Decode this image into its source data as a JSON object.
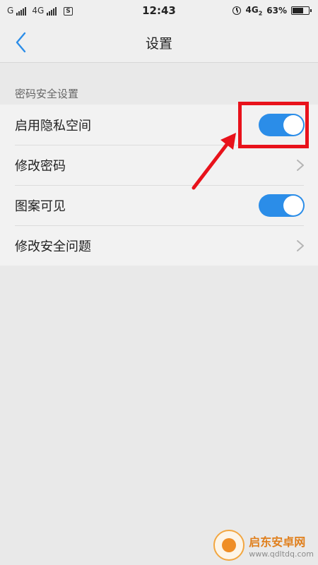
{
  "status_bar": {
    "carrier1": "G",
    "carrier2": "4G",
    "sim_badge": "S",
    "time": "12:43",
    "network": "4G",
    "network_sub": "2",
    "battery_percent": "63%",
    "battery_level": 0.63
  },
  "header": {
    "title": "设置",
    "back_icon": "chevron-left-icon"
  },
  "section": {
    "title": "密码安全设置",
    "rows": [
      {
        "label": "启用隐私空间",
        "control": "toggle",
        "on": true
      },
      {
        "label": "修改密码",
        "control": "chevron"
      },
      {
        "label": "图案可见",
        "control": "toggle",
        "on": true
      },
      {
        "label": "修改安全问题",
        "control": "chevron"
      }
    ]
  },
  "colors": {
    "toggle_on": "#2b8de8",
    "highlight": "#e8121b",
    "back_icon": "#2b8de8"
  },
  "watermark": {
    "name": "启东安卓网",
    "url": "www.qdltdq.com"
  }
}
